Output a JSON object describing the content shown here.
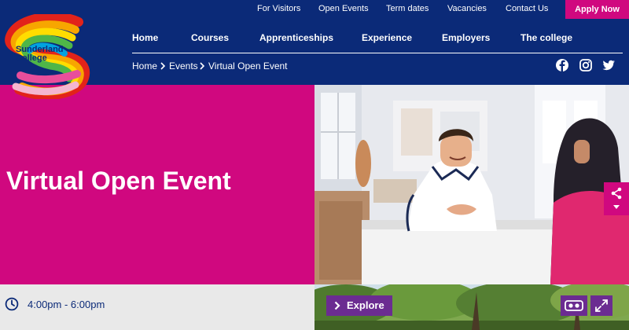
{
  "brand": {
    "logo_text_line1": "Sunderland",
    "logo_text_line2": "College",
    "colors": {
      "navy": "#0b2a78",
      "magenta": "#d0087f",
      "purple": "#6b2c91"
    }
  },
  "utility_nav": {
    "items": [
      "For Visitors",
      "Open Events",
      "Term dates",
      "Vacancies",
      "Contact Us"
    ],
    "apply_label": "Apply Now"
  },
  "main_nav": {
    "items": [
      "Home",
      "Courses",
      "Apprenticeships",
      "Experience",
      "Employers",
      "The college"
    ]
  },
  "breadcrumb": {
    "items": [
      "Home",
      "Events",
      "Virtual Open Event"
    ],
    "separator_icon": "chevron-right-icon"
  },
  "social": {
    "icons": [
      "facebook-icon",
      "instagram-icon",
      "twitter-icon"
    ]
  },
  "hero": {
    "title": "Virtual Open Event",
    "photo_icon": "student-nurse-photo"
  },
  "share": {
    "icon": "share-icon",
    "caret_icon": "caret-down-icon"
  },
  "event": {
    "time": "4:00pm - 6:00pm",
    "clock_icon": "clock-icon"
  },
  "tour": {
    "explore_label": "Explore",
    "vr_icon": "vr-headset-icon",
    "fullscreen_icon": "fullscreen-icon"
  }
}
